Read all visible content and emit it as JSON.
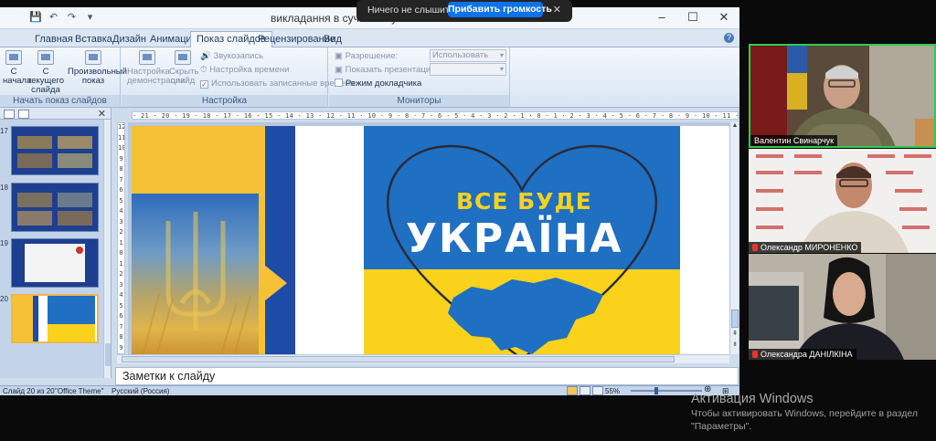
{
  "window": {
    "title": "викладання в сучасних умовах - Microsoft PowerPoint",
    "controls": [
      "–",
      "☐",
      "✕"
    ]
  },
  "ribbon": {
    "tabs": [
      "Главная",
      "Вставка",
      "Дизайн",
      "Анимация",
      "Показ слайдов",
      "Рецензирование",
      "Вид"
    ],
    "active_tab": "Показ слайдов",
    "groups": {
      "start": {
        "label": "Начать показ слайдов",
        "from_start": "С начала",
        "from_current": "С текущего слайда",
        "custom": "Произвольный показ"
      },
      "setup": {
        "label": "Настройка",
        "setup_demo": "Настройка демонстрации",
        "hide_slide": "Скрыть слайд",
        "record_narration": "Звукозапись",
        "rehearse_timings": "Настройка времени",
        "use_timings": "Использовать записанные времена"
      },
      "monitors": {
        "label": "Мониторы",
        "resolution_label": "Разрешение:",
        "resolution_value": "Использовать теку...",
        "show_on_label": "Показать презентацию на:",
        "presenter_view": "Режим докладчика"
      }
    }
  },
  "slides_pane": {
    "thumbnails": [
      {
        "number": "17"
      },
      {
        "number": "18"
      },
      {
        "number": "19"
      },
      {
        "number": "20",
        "selected": true
      }
    ]
  },
  "ruler": {
    "horizontal": "· 21 · 20 · 19 · 18 · 17 · 16 · 15 · 14 · 13 · 12 · 11 · 10 · 9 · 8 · 7 · 6 · 5 · 4 · 3 · 2 · 1 · 0 · 1 · 2 · 3 · 4 · 5 · 6 · 7 · 8 · 9 · 10 · 11 · 12 · 13 · 14 · 15 · 16 · 17 · 18 · 19 · 20 · 21 · 22 ·",
    "vertical": [
      "12",
      "11",
      "10",
      "9",
      "8",
      "7",
      "6",
      "5",
      "4",
      "3",
      "2",
      "1",
      "0",
      "1",
      "2",
      "3",
      "4",
      "5",
      "6",
      "7",
      "8",
      "9"
    ]
  },
  "slide": {
    "line1": "ВСЕ БУДЕ",
    "line2": "УКРАЇНА",
    "colors": {
      "blue": "#1f6fc2",
      "yellow": "#fad21c"
    }
  },
  "notes": {
    "placeholder": "Заметки к слайду"
  },
  "status": {
    "slide_counter": "Слайд 20 из 20",
    "theme": "\"Office Theme\"",
    "language": "Русский (Россия)",
    "zoom": "55%"
  },
  "zoom_banner": {
    "question": "Ничего не слышите?",
    "button": "Прибавить громкость",
    "close": "✕"
  },
  "participants": [
    {
      "name": "Валентин Свинарчук"
    },
    {
      "name": "Олександр МИРОНЕНКО",
      "muted": true
    },
    {
      "name": "Олександра ДАНІЛКІНА",
      "muted": true
    }
  ],
  "activation": {
    "title": "Активация Windows",
    "line1": "Чтобы активировать Windows, перейдите в раздел",
    "line2": "\"Параметры\"."
  }
}
